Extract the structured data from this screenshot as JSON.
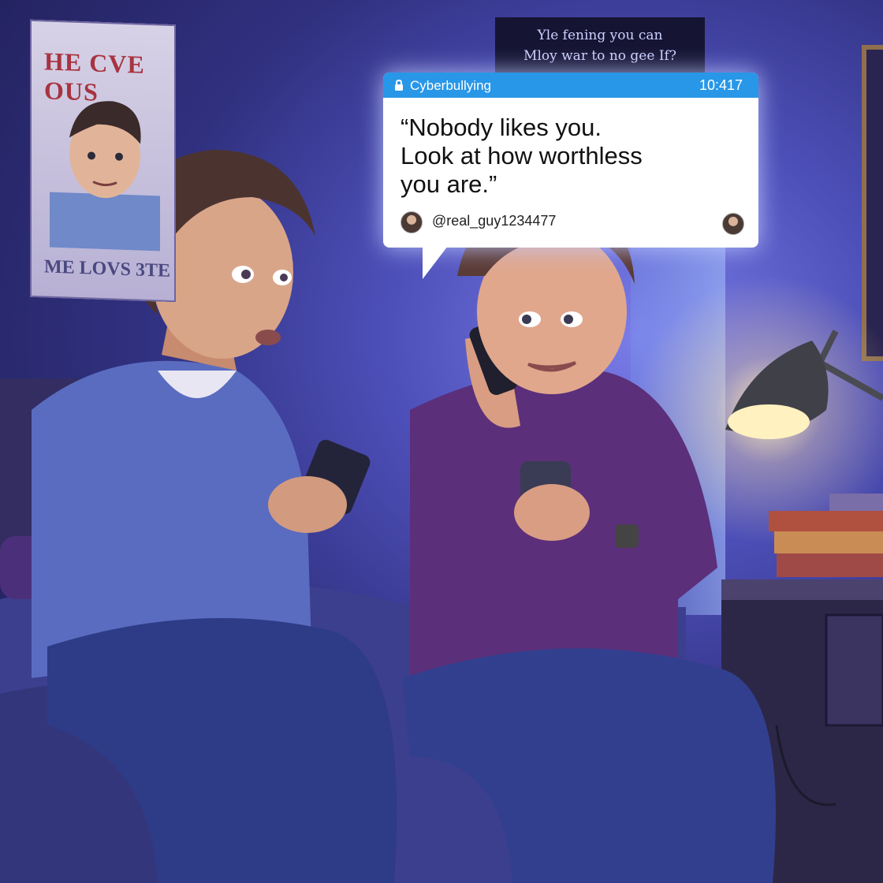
{
  "poster": {
    "top_text": "HE CVE OUS",
    "bottom_text": "ME LOVS 3TE"
  },
  "wall_sign": {
    "line1": "Yle fening you can",
    "line2": "Mloy war to no gee If?"
  },
  "message": {
    "app_label": "Cyberbullying",
    "time": "10:417",
    "text": "“Nobody likes you.\n Look at how worthless\nyou are.”",
    "handle": "@real_guy1234477"
  },
  "colors": {
    "accent": "#2897e8",
    "wall": "#3b3a9a",
    "lamp_glow": "#ffe7a8",
    "shirt": "#5b2f7a",
    "hoodie": "#5a6cc0"
  },
  "icons": {
    "lock": "lock-icon"
  }
}
